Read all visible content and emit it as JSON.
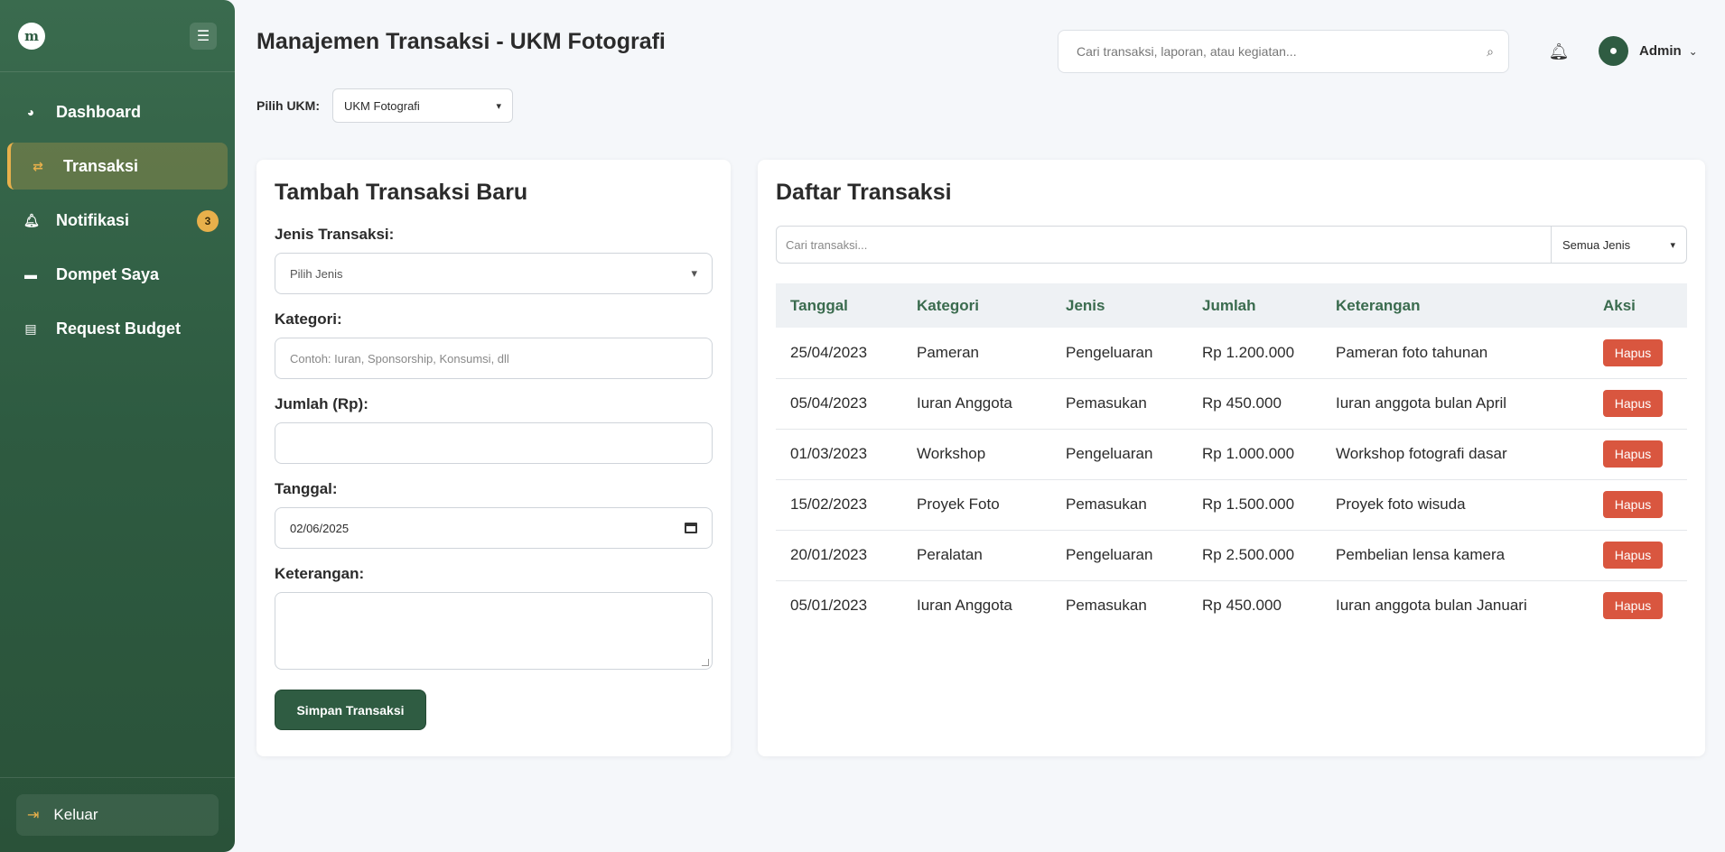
{
  "sidebar": {
    "logo_text": "m",
    "toggle_icon": "hamburger-icon",
    "items": [
      {
        "label": "Dashboard",
        "icon": "dashboard-gauge-icon"
      },
      {
        "label": "Transaksi",
        "icon": "exchange-arrows-icon",
        "active": true
      },
      {
        "label": "Notifikasi",
        "icon": "bell-icon",
        "badge": "3"
      },
      {
        "label": "Dompet Saya",
        "icon": "wallet-icon"
      },
      {
        "label": "Request Budget",
        "icon": "document-icon"
      }
    ],
    "logout_label": "Keluar"
  },
  "header": {
    "title": "Manajemen Transaksi - UKM Fotografi",
    "ukm_label": "Pilih UKM:",
    "ukm_selected": "UKM Fotografi",
    "search_placeholder": "Cari transaksi, laporan, atau kegiatan...",
    "user_name": "Admin"
  },
  "form": {
    "title": "Tambah Transaksi Baru",
    "jenis_label": "Jenis Transaksi:",
    "jenis_value": "Pilih Jenis",
    "kategori_label": "Kategori:",
    "kategori_placeholder": "Contoh: Iuran, Sponsorship, Konsumsi, dll",
    "jumlah_label": "Jumlah (Rp):",
    "jumlah_value": "",
    "tanggal_label": "Tanggal:",
    "tanggal_value": "02/06/2025",
    "keterangan_label": "Keterangan:",
    "keterangan_value": "",
    "save_label": "Simpan Transaksi"
  },
  "list": {
    "title": "Daftar Transaksi",
    "search_placeholder": "Cari transaksi...",
    "filter_selected": "Semua Jenis",
    "columns": [
      "Tanggal",
      "Kategori",
      "Jenis",
      "Jumlah",
      "Keterangan",
      "Aksi"
    ],
    "delete_label": "Hapus",
    "rows": [
      {
        "tanggal": "25/04/2023",
        "kategori": "Pameran",
        "jenis": "Pengeluaran",
        "jumlah": "Rp 1.200.000",
        "keterangan": "Pameran foto tahunan"
      },
      {
        "tanggal": "05/04/2023",
        "kategori": "Iuran Anggota",
        "jenis": "Pemasukan",
        "jumlah": "Rp 450.000",
        "keterangan": "Iuran anggota bulan April"
      },
      {
        "tanggal": "01/03/2023",
        "kategori": "Workshop",
        "jenis": "Pengeluaran",
        "jumlah": "Rp 1.000.000",
        "keterangan": "Workshop fotografi dasar"
      },
      {
        "tanggal": "15/02/2023",
        "kategori": "Proyek Foto",
        "jenis": "Pemasukan",
        "jumlah": "Rp 1.500.000",
        "keterangan": "Proyek foto wisuda"
      },
      {
        "tanggal": "20/01/2023",
        "kategori": "Peralatan",
        "jenis": "Pengeluaran",
        "jumlah": "Rp 2.500.000",
        "keterangan": "Pembelian lensa kamera"
      },
      {
        "tanggal": "05/01/2023",
        "kategori": "Iuran Anggota",
        "jenis": "Pemasukan",
        "jumlah": "Rp 450.000",
        "keterangan": "Iuran anggota bulan Januari"
      }
    ]
  },
  "colors": {
    "sidebar": "#2e5b41",
    "accent": "#e8b04b",
    "primary_button": "#2f5c42",
    "danger": "#d9563f",
    "table_header_text": "#3a6b4e"
  }
}
